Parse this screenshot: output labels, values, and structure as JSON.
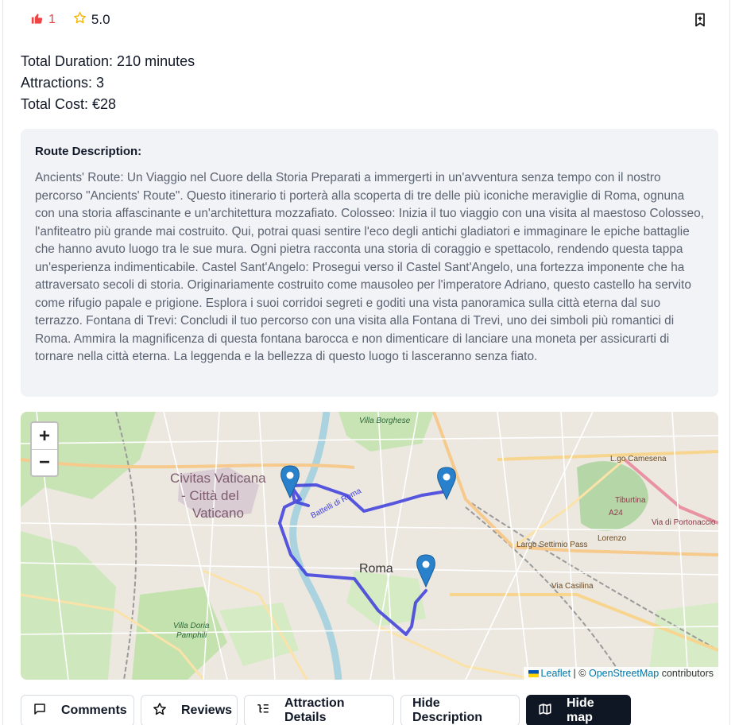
{
  "header": {
    "likes": "1",
    "rating": "5.0",
    "colors": {
      "like": "#ef4444",
      "star": "#f5b400"
    },
    "icons": [
      "thumbs-up-icon",
      "star-icon",
      "bookmark-plus-icon"
    ]
  },
  "stats": {
    "duration": "Total Duration: 210 minutes",
    "attractions": "Attractions: 3",
    "cost": "Total Cost: €28"
  },
  "description": {
    "title": "Route Description:",
    "text": "Ancients' Route: Un Viaggio nel Cuore della Storia Preparati a immergerti in un'avventura senza tempo con il nostro percorso \"Ancients' Route\". Questo itinerario ti porterà alla scoperta di tre delle più iconiche meraviglie di Roma, ognuna con una storia affascinante e un'architettura mozzafiato. Colosseo: Inizia il tuo viaggio con una visita al maestoso Colosseo, l'anfiteatro più grande mai costruito. Qui, potrai quasi sentire l'eco degli antichi gladiatori e immaginare le epiche battaglie che hanno avuto luogo tra le sue mura. Ogni pietra racconta una storia di coraggio e spettacolo, rendendo questa tappa un'esperienza indimenticabile. Castel Sant'Angelo: Prosegui verso il Castel Sant'Angelo, una fortezza imponente che ha attraversato secoli di storia. Originariamente costruito come mausoleo per l'imperatore Adriano, questo castello ha servito come rifugio papale e prigione. Esplora i suoi corridoi segreti e goditi una vista panoramica sulla città eterna dal suo terrazzo. Fontana di Trevi: Concludi il tuo percorso con una visita alla Fontana di Trevi, uno dei simboli più romantici di Roma. Ammira la magnificenza di questa fontana barocca e non dimenticare di lanciare una moneta per assicurarti di tornare nella città eterna. La leggenda e la bellezza di questo luogo ti lasceranno senza fiato."
  },
  "map": {
    "zoom_in": "+",
    "zoom_out": "−",
    "labels": {
      "vatican_1": "Civitas Vaticana",
      "vatican_2": "- Città del",
      "vatican_3": "Vaticano",
      "roma": "Roma",
      "villa_borghese": "Villa Borghese",
      "villa_doria": "Villa Doria",
      "pamphilj": "Pamphili",
      "tiburtina": "Tiburtina",
      "largo_settimio": "Largo Settimio Pass",
      "via_casilina": "Via Casilina",
      "lgo_camesena": "L.go Camesena",
      "via_portonaccio": "Via di Portonaccio",
      "lorenzo": "Lorenzo",
      "battelli": "Battelli di Roma",
      "a24": "A24"
    },
    "attribution": {
      "leaflet": "Leaflet",
      "sep": " | © ",
      "osm": "OpenStreetMap",
      "contributors": " contributors"
    },
    "route_color": "#3b3bdc",
    "marker_color": "#2a81cb"
  },
  "actions": {
    "comments": "Comments",
    "reviews": "Reviews",
    "details": "Attraction Details",
    "hide_description": "Hide Description",
    "hide_map": "Hide map"
  }
}
